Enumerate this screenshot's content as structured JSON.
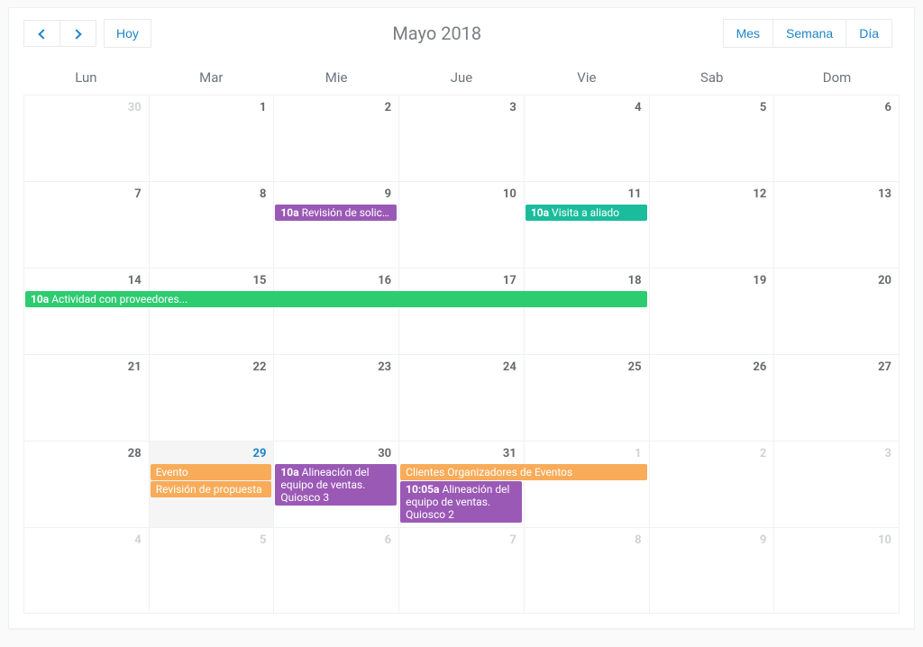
{
  "title": "Mayo 2018",
  "toolbar": {
    "today_label": "Hoy",
    "views": {
      "month": "Mes",
      "week": "Semana",
      "day": "Día"
    }
  },
  "dow": [
    "Lun",
    "Mar",
    "Mie",
    "Jue",
    "Vie",
    "Sab",
    "Dom"
  ],
  "weeks": [
    {
      "days": [
        {
          "n": "30",
          "other": true
        },
        {
          "n": "1"
        },
        {
          "n": "2"
        },
        {
          "n": "3"
        },
        {
          "n": "4"
        },
        {
          "n": "5"
        },
        {
          "n": "6"
        }
      ]
    },
    {
      "days": [
        {
          "n": "7"
        },
        {
          "n": "8"
        },
        {
          "n": "9"
        },
        {
          "n": "10"
        },
        {
          "n": "11"
        },
        {
          "n": "12"
        },
        {
          "n": "13"
        }
      ]
    },
    {
      "days": [
        {
          "n": "14"
        },
        {
          "n": "15"
        },
        {
          "n": "16"
        },
        {
          "n": "17"
        },
        {
          "n": "18"
        },
        {
          "n": "19"
        },
        {
          "n": "20"
        }
      ]
    },
    {
      "days": [
        {
          "n": "21"
        },
        {
          "n": "22"
        },
        {
          "n": "23"
        },
        {
          "n": "24"
        },
        {
          "n": "25"
        },
        {
          "n": "26"
        },
        {
          "n": "27"
        }
      ]
    },
    {
      "days": [
        {
          "n": "28"
        },
        {
          "n": "29",
          "today": true
        },
        {
          "n": "30"
        },
        {
          "n": "31"
        },
        {
          "n": "1",
          "other": true
        },
        {
          "n": "2",
          "other": true
        },
        {
          "n": "3",
          "other": true
        }
      ]
    },
    {
      "days": [
        {
          "n": "4",
          "other": true
        },
        {
          "n": "5",
          "other": true
        },
        {
          "n": "6",
          "other": true
        },
        {
          "n": "7",
          "other": true
        },
        {
          "n": "8",
          "other": true
        },
        {
          "n": "9",
          "other": true
        },
        {
          "n": "10",
          "other": true
        }
      ]
    }
  ],
  "events_by_week": {
    "1": [
      {
        "time": "10a",
        "title": "Revisión de solicitud",
        "color": "ev-purple",
        "startCol": 2,
        "span": 1,
        "row": 0,
        "tall": false
      },
      {
        "time": "10a",
        "title": "Visita a aliado",
        "color": "ev-green",
        "startCol": 4,
        "span": 1,
        "row": 0,
        "tall": false
      }
    ],
    "2": [
      {
        "time": "10a",
        "title": "Actividad con proveedores...",
        "color": "ev-green2",
        "startCol": 0,
        "span": 5,
        "row": 0,
        "tall": false
      }
    ],
    "4": [
      {
        "time": "",
        "title": "Evento",
        "color": "ev-yellow",
        "startCol": 1,
        "span": 1,
        "row": 0,
        "tall": false
      },
      {
        "time": "",
        "title": "Revisión de propuesta",
        "color": "ev-yellow",
        "startCol": 1,
        "span": 1,
        "row": 1,
        "tall": false
      },
      {
        "time": "10a",
        "title": "Alineación del equipo de ventas. Quiosco 3",
        "color": "ev-purple",
        "startCol": 2,
        "span": 1,
        "row": 0,
        "tall": true
      },
      {
        "time": "",
        "title": "Clientes Organizadores de Eventos",
        "color": "ev-yellow",
        "startCol": 3,
        "span": 2,
        "row": 0,
        "tall": false
      },
      {
        "time": "10:05a",
        "title": "Alineación del equipo de ventas. Quiosco 2",
        "color": "ev-purple",
        "startCol": 3,
        "span": 1,
        "row": 1,
        "tall": true
      }
    ]
  },
  "colors": {
    "accent": "#1c84c6",
    "purple": "#9b59b6",
    "green": "#1abc9c",
    "green2": "#2ecc71",
    "yellow": "#f8ac59"
  }
}
